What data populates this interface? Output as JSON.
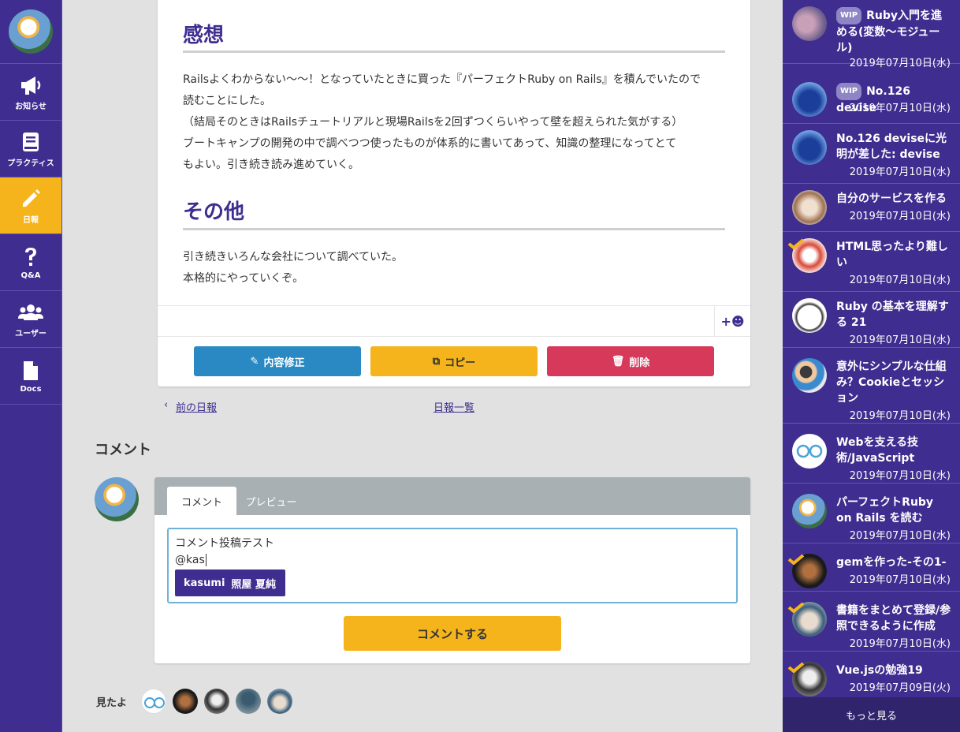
{
  "nav": {
    "items": [
      {
        "label": "お知らせ",
        "icon": "megaphone-icon"
      },
      {
        "label": "プラクティス",
        "icon": "book-icon"
      },
      {
        "label": "日報",
        "icon": "pencil-icon"
      },
      {
        "label": "Q&A",
        "icon": "question-icon"
      },
      {
        "label": "ユーザー",
        "icon": "users-icon"
      },
      {
        "label": "Docs",
        "icon": "document-icon"
      }
    ]
  },
  "report": {
    "section1_title": "感想",
    "section1_lines": [
      "Railsよくわからない〜〜！となっていたときに買った『パーフェクトRuby on Rails』を積んでいたので",
      "読むことにした。",
      "（結局そのときはRailsチュートリアルと現場Railsを2回ずつくらいやって壁を超えられた気がする）",
      "ブートキャンプの開発の中で調べつつ使ったものが体系的に書いてあって、知識の整理になってとて",
      "もよい。引き続き読み進めていく。"
    ],
    "section2_title": "その他",
    "section2_lines": [
      "引き続きいろんな会社について調べていた。",
      "本格的にやっていくぞ。"
    ],
    "emoji_button": "+☻",
    "edit_label": "内容修正",
    "copy_label": "コピー",
    "delete_label": "削除"
  },
  "links": {
    "prev": "前の日報",
    "list": "日報一覧"
  },
  "comment": {
    "heading": "コメント",
    "tab_comment": "コメント",
    "tab_preview": "プレビュー",
    "text_line1": "コメント投稿テスト",
    "text_line2": "@kas",
    "mention_user": "kasumi",
    "mention_name": "照屋 夏純",
    "submit_label": "コメントする"
  },
  "seen": {
    "label": "見たよ"
  },
  "sidebar": {
    "items": [
      {
        "wip": "WIP",
        "title": "Ruby入門を進める(変数〜モジュール)",
        "date": "2019年07月10日(水)",
        "checked": false
      },
      {
        "wip": "WIP",
        "title": "No.126 devise",
        "date": "2019年07月10日(水)",
        "checked": false
      },
      {
        "wip": "",
        "title": "No.126 deviseに光明が差した: devise",
        "date": "2019年07月10日(水)",
        "checked": false
      },
      {
        "wip": "",
        "title": "自分のサービスを作る",
        "date": "2019年07月10日(水)",
        "checked": false
      },
      {
        "wip": "",
        "title": "HTML思ったより難しい",
        "date": "2019年07月10日(水)",
        "checked": true
      },
      {
        "wip": "",
        "title": "Ruby の基本を理解する 21",
        "date": "2019年07月10日(水)",
        "checked": false
      },
      {
        "wip": "",
        "title": "意外にシンプルな仕組み？Cookieとセッション",
        "date": "2019年07月10日(水)",
        "checked": false
      },
      {
        "wip": "",
        "title": "Webを支える技術/JavaScript",
        "date": "2019年07月10日(水)",
        "checked": false
      },
      {
        "wip": "",
        "title": "パーフェクトRuby on Rails を読む",
        "date": "2019年07月10日(水)",
        "checked": false
      },
      {
        "wip": "",
        "title": "gemを作った-その1-",
        "date": "2019年07月10日(水)",
        "checked": true
      },
      {
        "wip": "",
        "title": "書籍をまとめて登録/参照できるように作成",
        "date": "2019年07月10日(水)",
        "checked": true
      },
      {
        "wip": "",
        "title": "Vue.jsの勉強19",
        "date": "2019年07月09日(火)",
        "checked": true
      }
    ],
    "more_label": "もっと見る"
  },
  "colors": {
    "brand_purple": "#3f2d8f",
    "accent_yellow": "#f5b41b",
    "edit_blue": "#2a89c2",
    "delete_red": "#d6395a"
  }
}
